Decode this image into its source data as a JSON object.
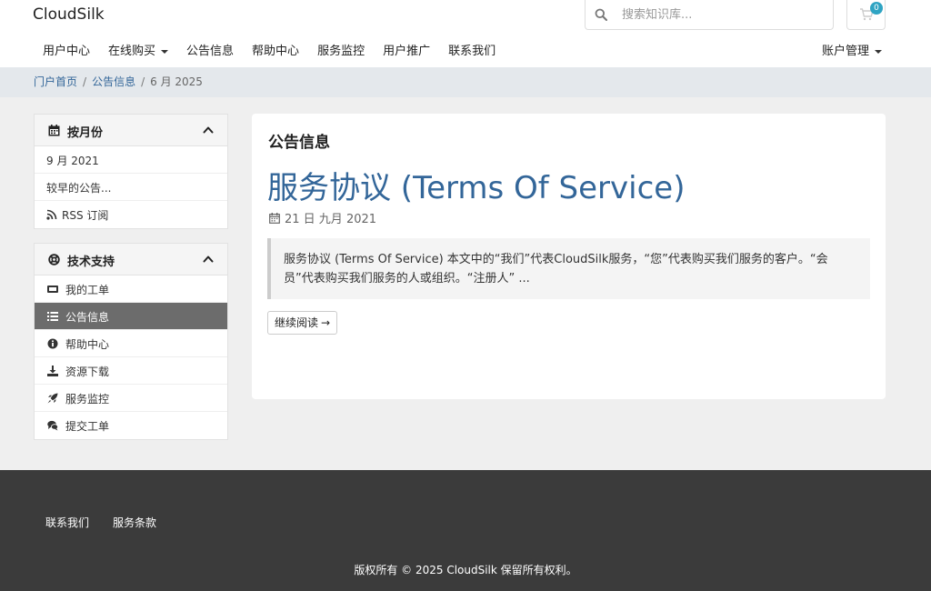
{
  "header": {
    "brand": "CloudSilk",
    "search_placeholder": "搜索知识库...",
    "cart_count": "0",
    "nav": [
      "用户中心",
      "在线购买",
      "公告信息",
      "帮助中心",
      "服务监控",
      "用户推广",
      "联系我们"
    ],
    "account": "账户管理"
  },
  "breadcrumb": {
    "home": "门户首页",
    "section": "公告信息",
    "current": "6 月 2025"
  },
  "sidebar": {
    "months": {
      "title": "按月份",
      "items": [
        "9 月 2021",
        "较早的公告...",
        "RSS 订阅"
      ]
    },
    "support": {
      "title": "技术支持",
      "items": [
        "我的工单",
        "公告信息",
        "帮助中心",
        "资源下载",
        "服务监控",
        "提交工单"
      ]
    }
  },
  "main": {
    "heading": "公告信息",
    "post_title": "服务协议 (Terms Of Service)",
    "post_date": "21 日 九月 2021",
    "excerpt": "服务协议 (Terms Of Service) 本文中的“我们”代表CloudSilk服务，“您”代表购买我们服务的客户。“会员”代表购买我们服务的人或组织。“注册人” ...",
    "read_more": "继续阅读"
  },
  "footer": {
    "links": [
      "联系我们",
      "服务条款"
    ],
    "copyright": "版权所有 © 2025 CloudSilk 保留所有权利。"
  },
  "colors": {
    "link": "#336699",
    "active_item": "#6c6c6c",
    "footer_bg": "#3b3b3b",
    "badge": "#2fa4c3"
  },
  "icons": {
    "search": "search-icon",
    "cart": "cart-icon",
    "calendar": "calendar-icon",
    "chevron_up": "chevron-up-icon",
    "rss": "rss-icon",
    "support": "life-ring-icon",
    "ticket": "ticket-icon",
    "list": "list-icon",
    "info": "info-icon",
    "download": "download-icon",
    "rocket": "rocket-icon",
    "comments": "comments-icon"
  }
}
